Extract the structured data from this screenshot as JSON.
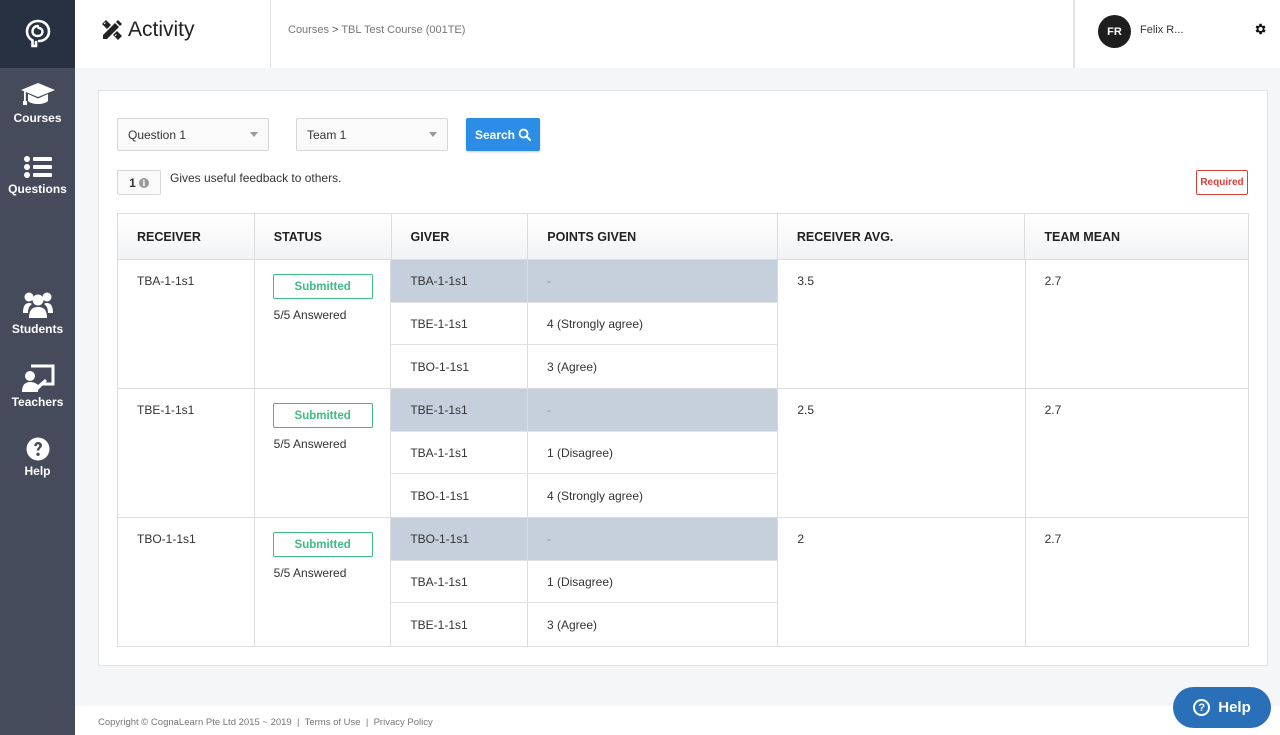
{
  "header": {
    "title": "Activity",
    "breadcrumb": {
      "root": "Courses",
      "separator": ">",
      "current": "TBL Test Course (001TE)"
    },
    "user": {
      "initials": "FR",
      "name": "Felix R..."
    }
  },
  "sidebar": {
    "items": [
      {
        "label": "Courses",
        "icon": "graduation-cap-icon"
      },
      {
        "label": "Questions",
        "icon": "list-icon"
      },
      {
        "label": "Students",
        "icon": "users-icon"
      },
      {
        "label": "Teachers",
        "icon": "chalkboard-teacher-icon"
      },
      {
        "label": "Help",
        "icon": "question-circle-icon"
      }
    ]
  },
  "filters": {
    "question_select": "Question 1",
    "team_select": "Team 1",
    "search_label": "Search"
  },
  "question": {
    "number": "1",
    "text": "Gives useful feedback to others.",
    "required_label": "Required"
  },
  "table": {
    "headers": [
      "RECEIVER",
      "STATUS",
      "GIVER",
      "POINTS GIVEN",
      "RECEIVER AVG.",
      "TEAM MEAN"
    ],
    "groups": [
      {
        "receiver": "TBA-1-1s1",
        "status": "Submitted",
        "answered": "5/5 Answered",
        "receiver_avg": "3.5",
        "team_mean": "2.7",
        "givers": [
          {
            "giver": "TBA-1-1s1",
            "points": "-"
          },
          {
            "giver": "TBE-1-1s1",
            "points": "4 (Strongly agree)"
          },
          {
            "giver": "TBO-1-1s1",
            "points": "3 (Agree)"
          }
        ]
      },
      {
        "receiver": "TBE-1-1s1",
        "status": "Submitted",
        "answered": "5/5 Answered",
        "receiver_avg": "2.5",
        "team_mean": "2.7",
        "givers": [
          {
            "giver": "TBE-1-1s1",
            "points": "-"
          },
          {
            "giver": "TBA-1-1s1",
            "points": "1 (Disagree)"
          },
          {
            "giver": "TBO-1-1s1",
            "points": "4 (Strongly agree)"
          }
        ]
      },
      {
        "receiver": "TBO-1-1s1",
        "status": "Submitted",
        "answered": "5/5 Answered",
        "receiver_avg": "2",
        "team_mean": "2.7",
        "givers": [
          {
            "giver": "TBO-1-1s1",
            "points": "-"
          },
          {
            "giver": "TBA-1-1s1",
            "points": "1 (Disagree)"
          },
          {
            "giver": "TBE-1-1s1",
            "points": "3 (Agree)"
          }
        ]
      }
    ]
  },
  "footer": {
    "copyright": "Copyright © CognaLearn Pte Ltd 2015 ~ 2019",
    "separator": "|",
    "terms": "Terms of Use",
    "privacy": "Privacy Policy"
  },
  "help_button": {
    "label": "Help"
  },
  "colors": {
    "sidebar": "#454b5a",
    "sidebar_logo": "#283142",
    "primary": "#2b8de5",
    "submitted": "#3dbd82",
    "required": "#d9403a",
    "self_row": "#c6d0dc",
    "help_fab": "#2a70b8"
  }
}
